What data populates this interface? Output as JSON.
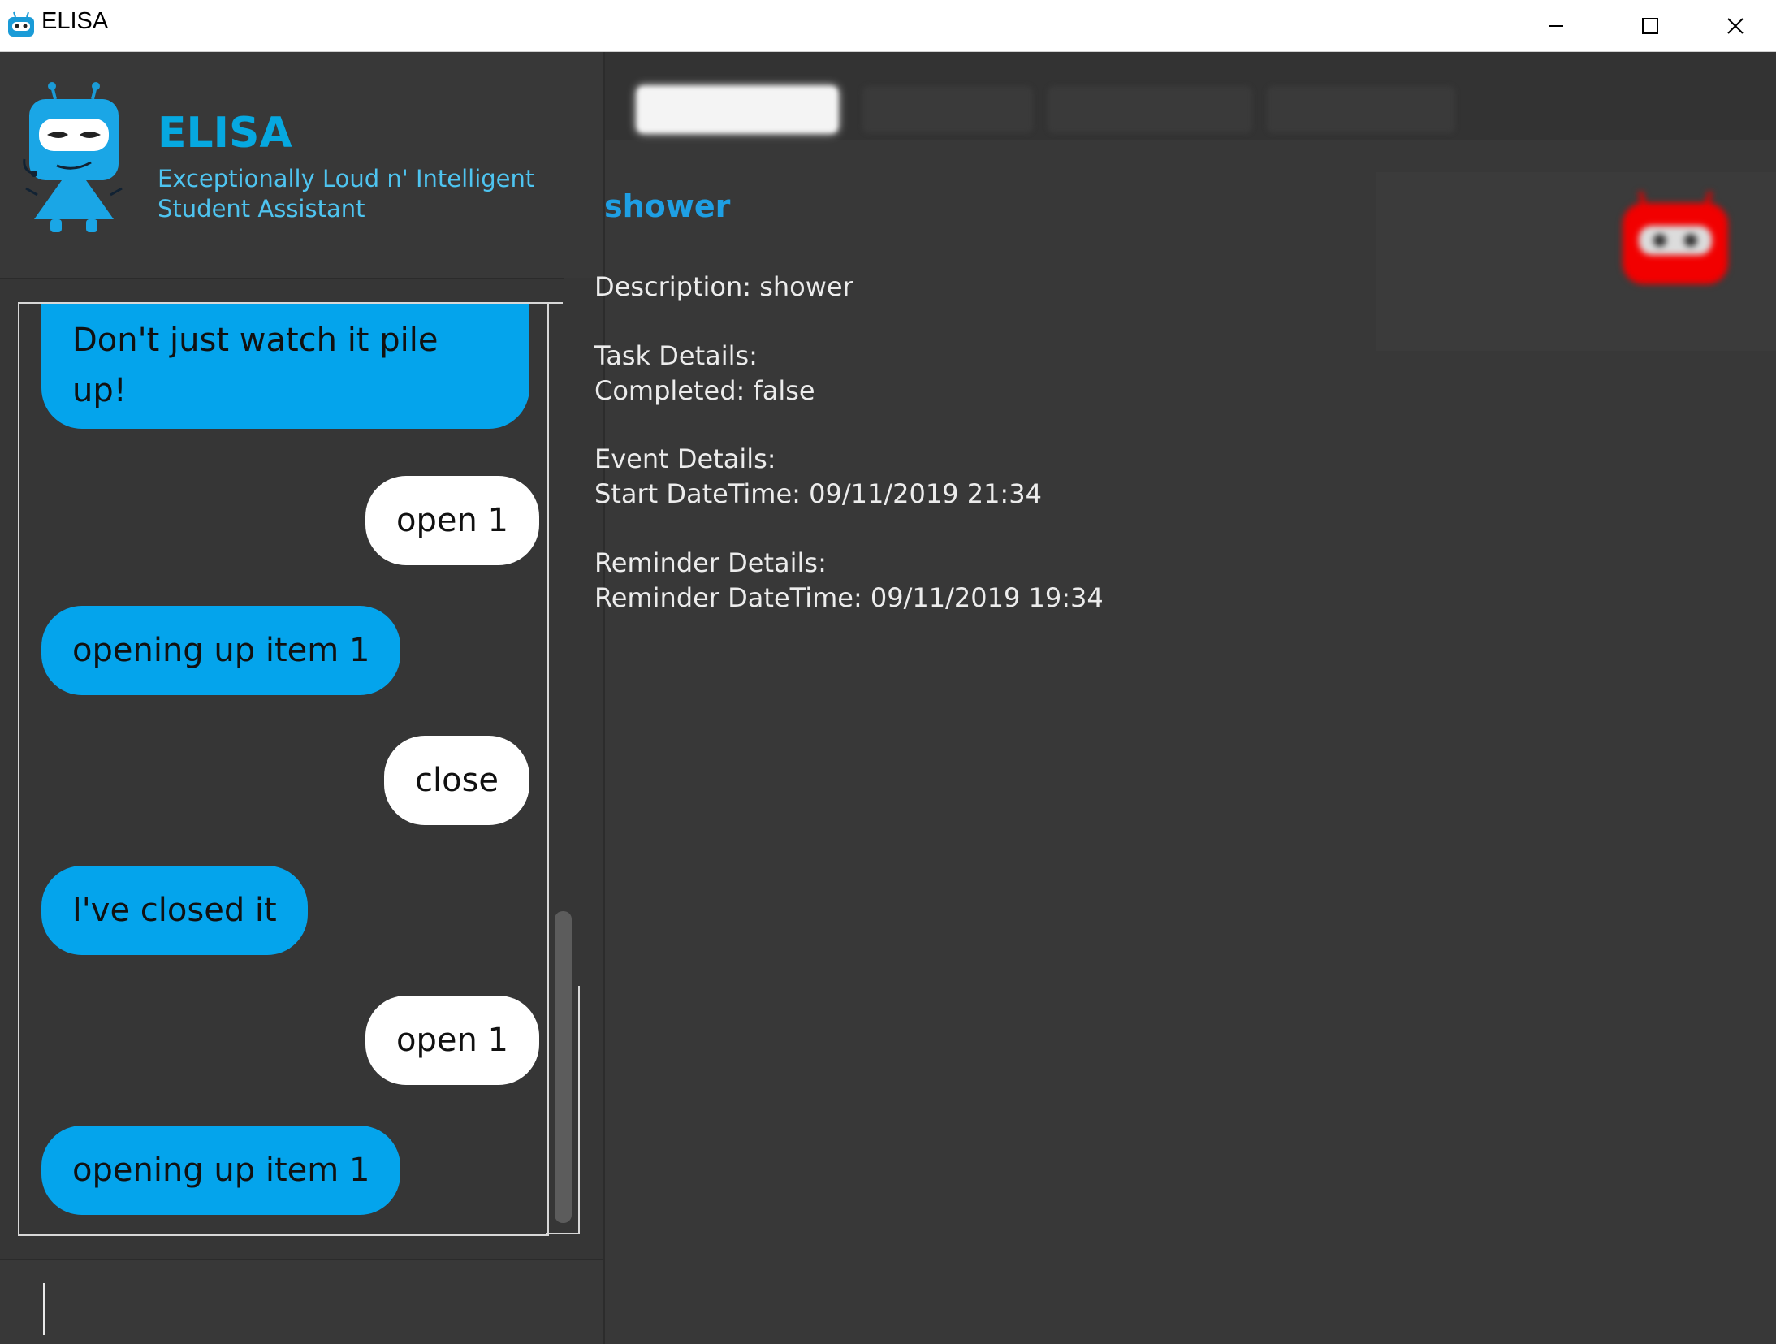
{
  "window": {
    "title": "ELISA"
  },
  "header": {
    "app_name": "ELISA",
    "subtitle_line1": "Exceptionally Loud n' Intelligent",
    "subtitle_line2": "Student Assistant"
  },
  "chat": {
    "messages": [
      {
        "from": "elisa",
        "text": "Don't just watch it pile up!"
      },
      {
        "from": "user",
        "text": "open 1"
      },
      {
        "from": "elisa",
        "text": "opening up item 1"
      },
      {
        "from": "user",
        "text": "close"
      },
      {
        "from": "elisa",
        "text": "I've closed it"
      },
      {
        "from": "user",
        "text": "open 1"
      },
      {
        "from": "elisa",
        "text": "opening up item 1"
      }
    ],
    "input_value": ""
  },
  "detail": {
    "title": "shower",
    "description": "Description: shower",
    "task_header": "Task Details:",
    "task_completed": "Completed: false",
    "event_header": "Event Details:",
    "event_start": "Start DateTime: 09/11/2019 21:34",
    "reminder_header": "Reminder Details:",
    "reminder_datetime": "Reminder DateTime: 09/11/2019 19:34"
  },
  "icons": {
    "app": "robot-icon",
    "minimize": "minimize-icon",
    "maximize": "maximize-icon",
    "close": "close-icon"
  },
  "colors": {
    "accent": "#06a8e0",
    "elisa_bubble": "#04a4ec",
    "user_bubble": "#ffffff",
    "background": "#383838",
    "bot_red": "#ff0000"
  }
}
